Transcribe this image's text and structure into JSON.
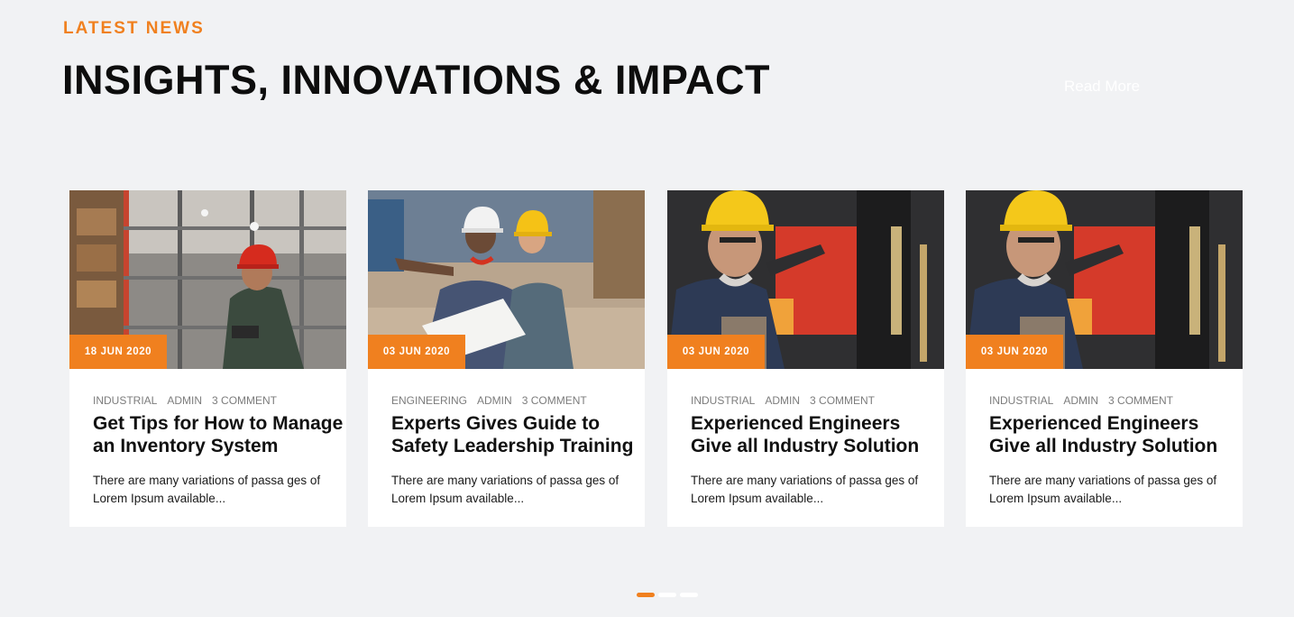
{
  "section": {
    "eyebrow": "LATEST NEWS",
    "headline": "INSIGHTS, INNOVATIONS & IMPACT",
    "read_more": "Read More"
  },
  "colors": {
    "accent": "#f0801f",
    "background": "#f1f2f4",
    "card": "#ffffff"
  },
  "cards": [
    {
      "image": "warehouse-worker-photo",
      "date": "18 JUN 2020",
      "category": "INDUSTRIAL",
      "author": "ADMIN",
      "comments": "3 COMMENT",
      "title": "Get Tips for How to Manage an Inventory System",
      "excerpt": "There are many variations of passa ges of Lorem Ipsum available..."
    },
    {
      "image": "engineers-site-photo",
      "date": "03 JUN 2020",
      "category": "ENGINEERING",
      "author": "ADMIN",
      "comments": "3 COMMENT",
      "title": "Experts Gives Guide to Safety Leadership Training",
      "excerpt": "There are many variations of passa ges of Lorem Ipsum available..."
    },
    {
      "image": "drill-press-worker-photo",
      "date": "03 JUN 2020",
      "category": "INDUSTRIAL",
      "author": "ADMIN",
      "comments": "3 COMMENT",
      "title": "Experienced Engineers Give all Industry Solution",
      "excerpt": "There are many variations of passa ges of Lorem Ipsum available..."
    },
    {
      "image": "drill-press-worker-photo",
      "date": "03 JUN 2020",
      "category": "INDUSTRIAL",
      "author": "ADMIN",
      "comments": "3 COMMENT",
      "title": "Experienced Engineers Give all Industry Solution",
      "excerpt": "There are many variations of passa ges of Lorem Ipsum available..."
    }
  ],
  "pagination": {
    "pages": 3,
    "active": 1
  }
}
